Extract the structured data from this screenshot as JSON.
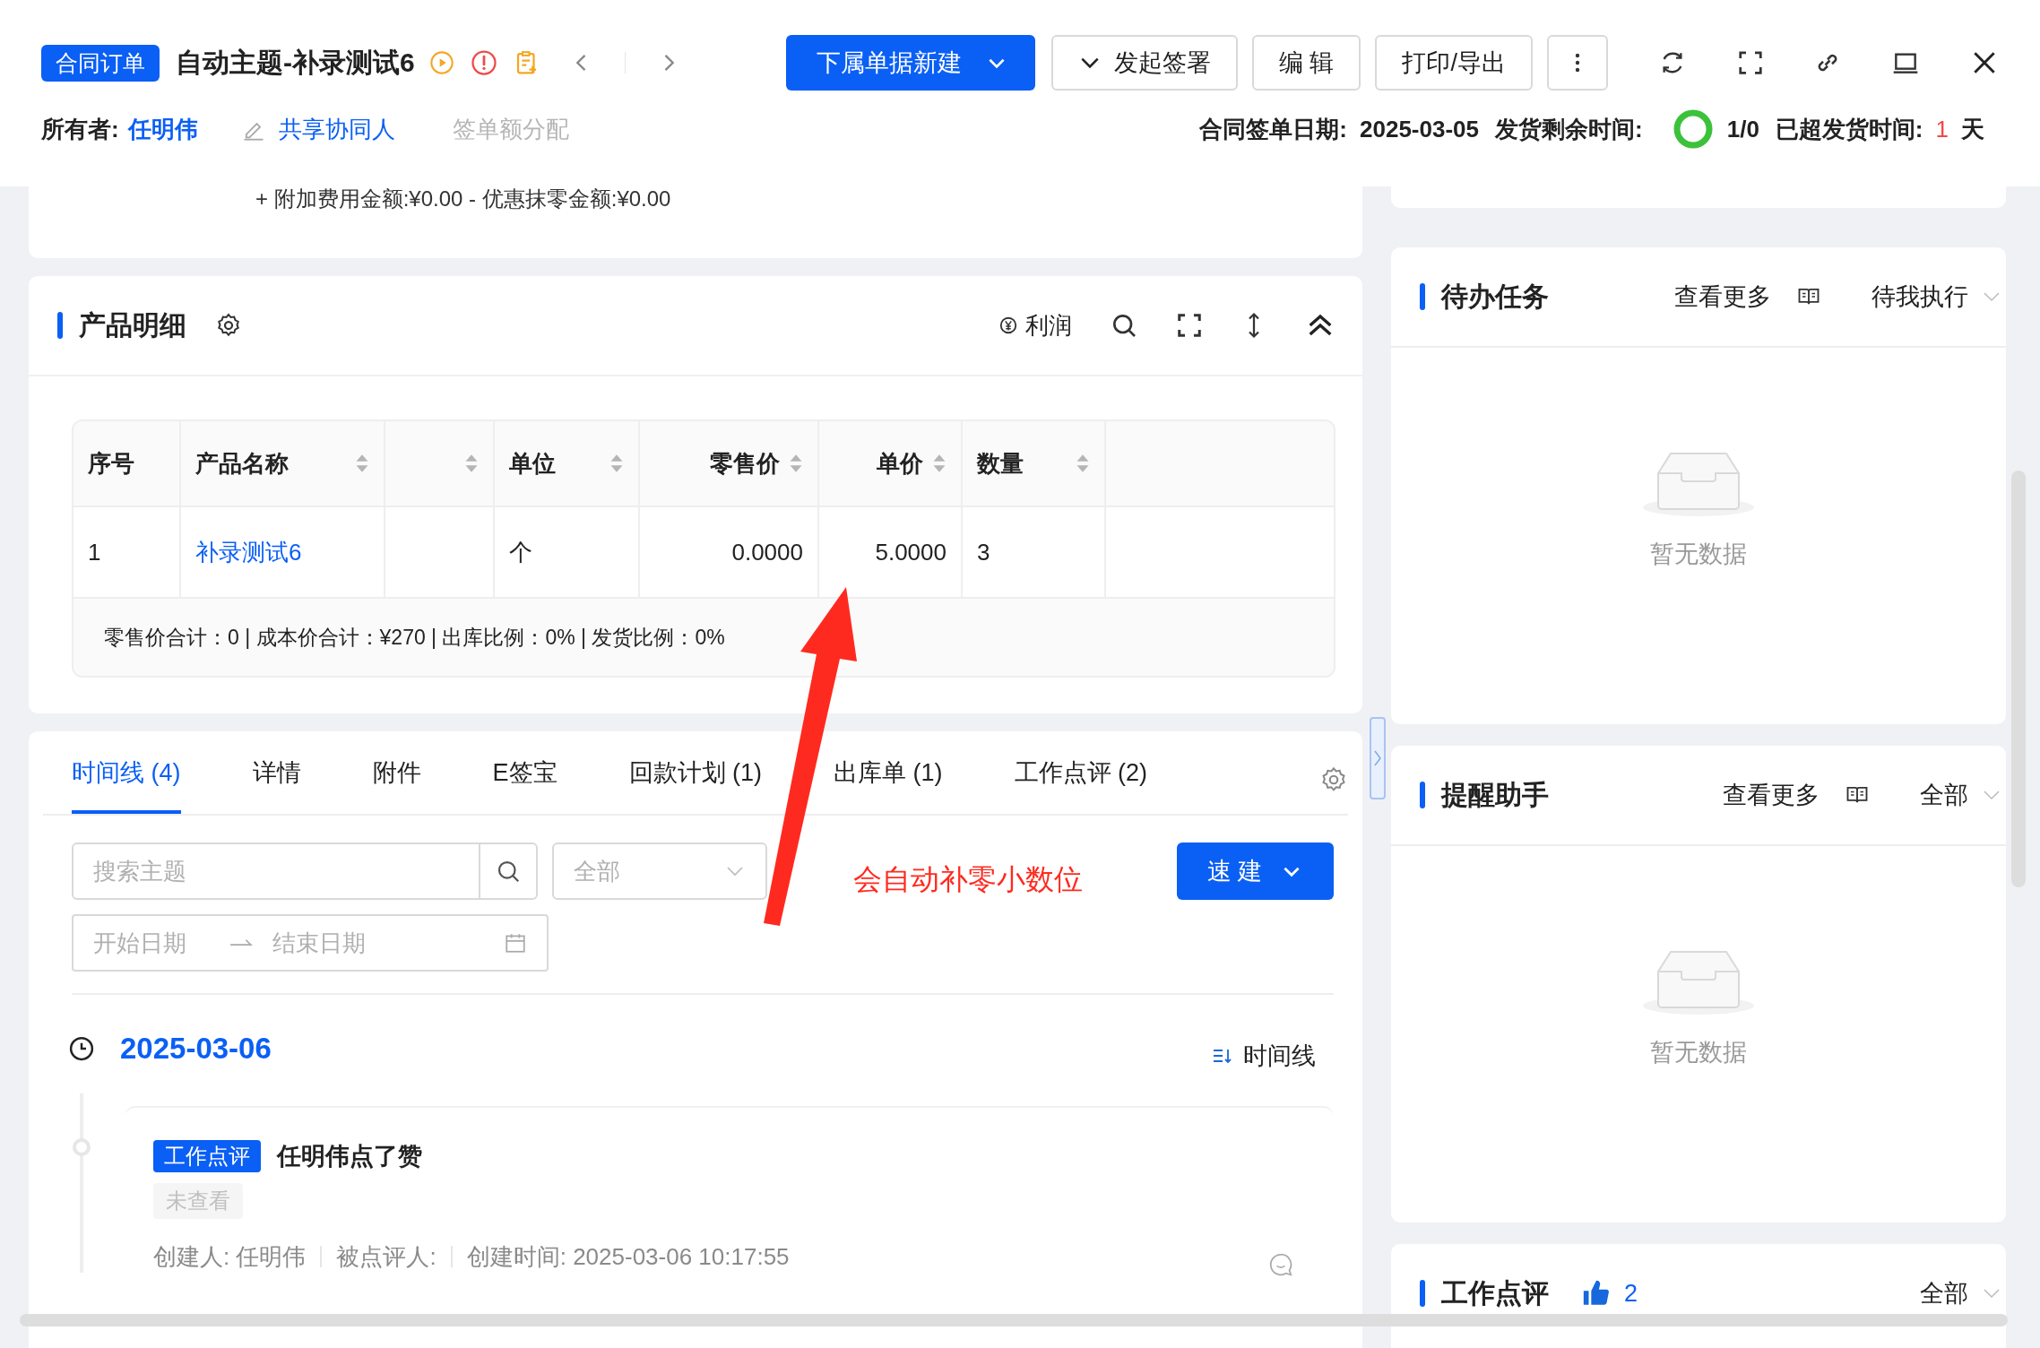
{
  "header": {
    "doc_type": "合同订单",
    "title": "自动主题-补录测试6",
    "owner_label": "所有者:",
    "owner": "任明伟",
    "share_link": "共享协同人",
    "allocation": {
      "label": "签单额分配",
      "disabled": true
    },
    "buttons": [
      {
        "kind": "primary",
        "label": "下属单据新建",
        "dropdown": true
      },
      {
        "kind": "default",
        "label": "发起签署",
        "dropdown": true
      },
      {
        "kind": "default",
        "label": "编 辑",
        "dropdown": false
      },
      {
        "kind": "default",
        "label": "打印/导出",
        "dropdown": false
      }
    ],
    "meta": {
      "sign_date_label": "合同签单日期:",
      "sign_date": "2025-03-05",
      "remaining_label": "发货剩余时间:",
      "remaining": "1/0",
      "overdue_label": "已超发货时间:",
      "overdue_value": "1",
      "overdue_unit": "天"
    }
  },
  "summary_line": "+ 附加费用金额:¥0.00 - 优惠抹零金额:¥0.00",
  "product_card": {
    "title": "产品明细",
    "profit_label": "利润",
    "table": {
      "columns": [
        {
          "label": "序号",
          "kind": "text",
          "sortable": false
        },
        {
          "label": "产品名称",
          "kind": "link",
          "sortable": true
        },
        {
          "kind": "blank",
          "sortable": true
        },
        {
          "label": "单位",
          "kind": "text",
          "sortable": true
        },
        {
          "label": "零售价",
          "kind": "number",
          "sortable": true
        },
        {
          "label": "单价",
          "kind": "number",
          "sortable": true
        },
        {
          "label": "数量",
          "kind": "text",
          "sortable": true
        }
      ],
      "rows": [
        {
          "cells": [
            "1",
            "补录测试6",
            "",
            "个",
            "0.0000",
            "5.0000",
            "3"
          ]
        }
      ],
      "footer": "零售价合计：0 | 成本价合计：¥270 | 出库比例：0% | 发货比例：0%"
    }
  },
  "detail_tabs": [
    {
      "label": "时间线 (4)",
      "selected": true
    },
    {
      "label": "详情",
      "selected": false
    },
    {
      "label": "附件",
      "selected": false
    },
    {
      "label": "E签宝",
      "selected": false
    },
    {
      "label": "回款计划 (1)",
      "selected": false
    },
    {
      "label": "出库单 (1)",
      "selected": false
    },
    {
      "label": "工作点评 (2)",
      "selected": false
    }
  ],
  "timeline_filters": {
    "search_placeholder": "搜索主题",
    "type_placeholder": "全部",
    "start_placeholder": "开始日期",
    "end_placeholder": "结束日期",
    "quick_create": "速 建"
  },
  "annotation": {
    "text": "会自动补零小数位"
  },
  "timeline": {
    "date": "2025-03-06",
    "view_label": "时间线",
    "entries": [
      {
        "tag": "工作点评",
        "title": "任明伟点了赞",
        "status": "未查看",
        "creator": "创建人: 任明伟",
        "reviewee": "被点评人:",
        "created": "创建时间: 2025-03-06 10:17:55"
      }
    ]
  },
  "side_panels": [
    {
      "kind": "list",
      "title": "待办任务",
      "more": "查看更多",
      "filter": "待我执行",
      "empty": "暂无数据"
    },
    {
      "kind": "list",
      "title": "提醒助手",
      "more": "查看更多",
      "filter": "全部",
      "empty": "暂无数据"
    },
    {
      "kind": "review",
      "title": "工作点评",
      "likes": "2",
      "filter": "全部"
    }
  ]
}
